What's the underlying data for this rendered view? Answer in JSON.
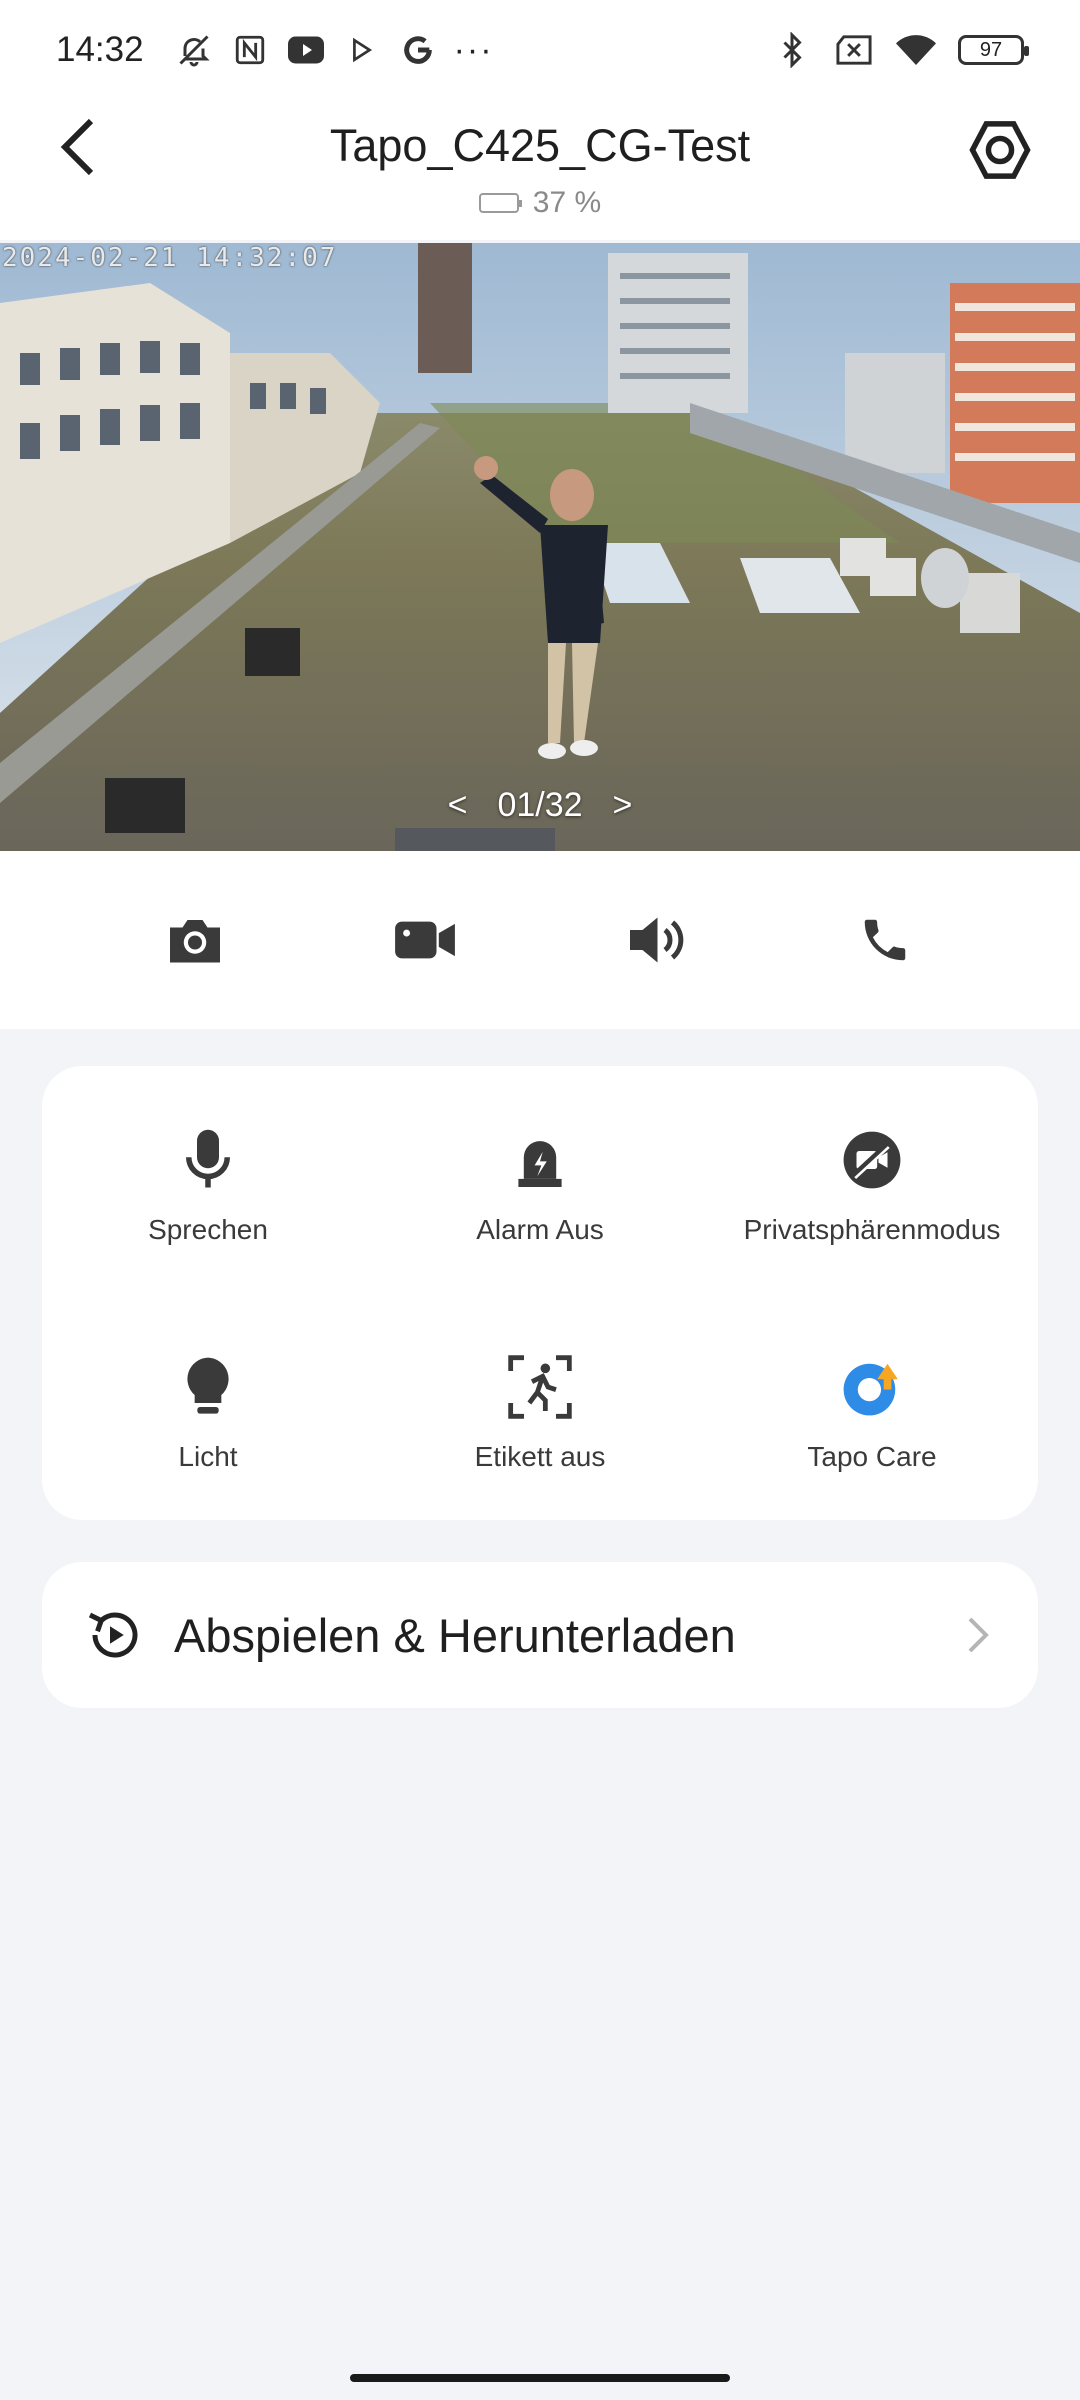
{
  "status_bar": {
    "time": "14:32",
    "more": "···",
    "battery_level": "97"
  },
  "header": {
    "title": "Tapo_C425_CG-Test",
    "battery_percent": "37 %"
  },
  "video": {
    "timestamp": "2024-02-21 14:32:07",
    "prev": "<",
    "clip_counter": "01/32",
    "next": ">"
  },
  "controls": [
    {
      "icon": "camera-icon"
    },
    {
      "icon": "video-record-icon"
    },
    {
      "icon": "speaker-icon"
    },
    {
      "icon": "phone-icon"
    }
  ],
  "features": [
    {
      "label": "Sprechen",
      "icon": "microphone-icon"
    },
    {
      "label": "Alarm Aus",
      "icon": "alarm-icon"
    },
    {
      "label": "Privatsphärenmodus",
      "icon": "privacy-camera-off-icon"
    },
    {
      "label": "Licht",
      "icon": "lightbulb-icon"
    },
    {
      "label": "Etikett aus",
      "icon": "motion-person-icon"
    },
    {
      "label": "Tapo Care",
      "icon": "tapo-care-icon"
    }
  ],
  "playback": {
    "label": "Abspielen & Herunterladen",
    "icon": "playback-history-icon"
  },
  "colors": {
    "background": "#f3f4f7",
    "card": "#ffffff",
    "icon": "#3a3a3a",
    "tapo_blue": "#2e8be6",
    "tapo_orange": "#f6a623"
  }
}
